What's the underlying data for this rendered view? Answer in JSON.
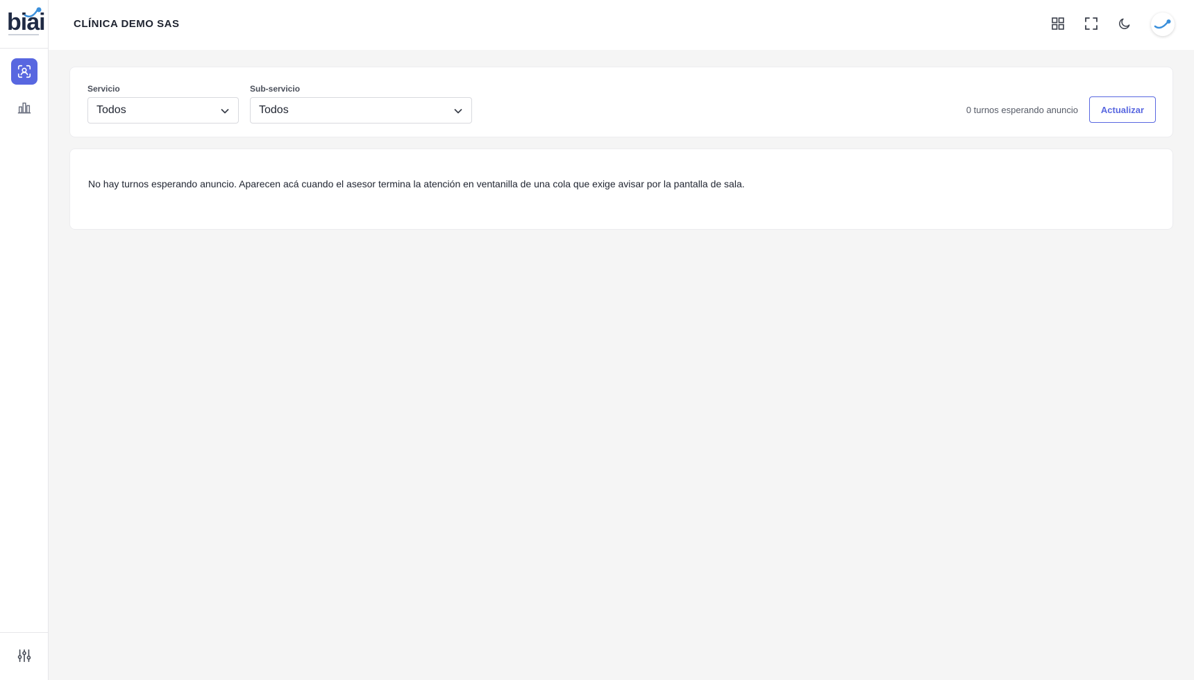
{
  "brand": {
    "logo_text": "biai",
    "accent": "#5867e0",
    "logo_blue": "#3a8fdb"
  },
  "sidebar": {
    "items": [
      {
        "icon": "person-scan-icon",
        "active": true
      },
      {
        "icon": "bar-chart-icon",
        "active": false
      }
    ],
    "bottom_icon": "sliders-icon"
  },
  "header": {
    "title": "CLÍNICA DEMO SAS",
    "icons": [
      "grid-icon",
      "fullscreen-icon",
      "moon-icon"
    ],
    "avatar_icon": "brand-swoosh-icon"
  },
  "filters": {
    "service": {
      "label": "Servicio",
      "value": "Todos"
    },
    "sub_service": {
      "label": "Sub-servicio",
      "value": "Todos"
    },
    "waiting_count_text": "0 turnos esperando anuncio",
    "refresh_label": "Actualizar"
  },
  "empty_state": {
    "message": "No hay turnos esperando anuncio. Aparecen acá cuando el asesor termina la atención en ventanilla de una cola que exige avisar por la pantalla de sala."
  }
}
